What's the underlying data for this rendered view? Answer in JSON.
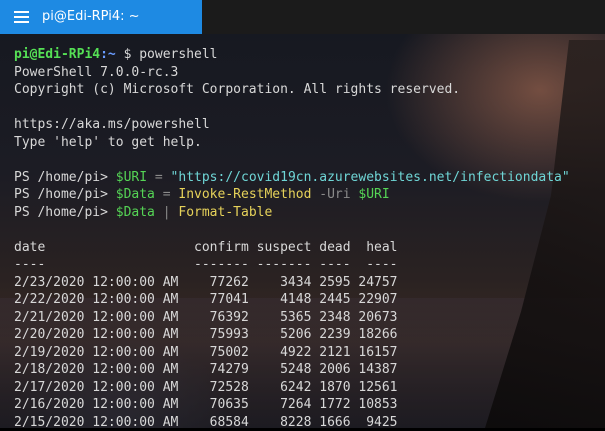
{
  "tab": {
    "title": "pi@Edi-RPi4: ~"
  },
  "terminal": {
    "prompt_user": "pi@Edi-RPi4",
    "prompt_path": ":~",
    "prompt_symbol": " $ ",
    "first_command": "powershell",
    "banner": [
      "PowerShell 7.0.0-rc.3",
      "Copyright (c) Microsoft Corporation. All rights reserved.",
      "",
      "https://aka.ms/powershell",
      "Type 'help' to get help.",
      ""
    ],
    "ps_prompt": "PS /home/pi> ",
    "commands": [
      {
        "var": "$URI",
        "op": " = ",
        "rest": "\"https://covid19cn.azurewebsites.net/infectiondata\""
      },
      {
        "var": "$Data",
        "op": " = ",
        "cmd": "Invoke-RestMethod",
        "param": " -Uri ",
        "var2": "$URI"
      },
      {
        "var": "$Data",
        "op": " | ",
        "cmd": "Format-Table"
      }
    ],
    "table_header": "date                   confirm suspect dead  heal",
    "table_rule": "----                   ------- ------- ----  ----",
    "rows": [
      {
        "date": "2/23/2020 12:00:00 AM",
        "confirm": "77262",
        "suspect": "3434",
        "dead": "2595",
        "heal": "24757"
      },
      {
        "date": "2/22/2020 12:00:00 AM",
        "confirm": "77041",
        "suspect": "4148",
        "dead": "2445",
        "heal": "22907"
      },
      {
        "date": "2/21/2020 12:00:00 AM",
        "confirm": "76392",
        "suspect": "5365",
        "dead": "2348",
        "heal": "20673"
      },
      {
        "date": "2/20/2020 12:00:00 AM",
        "confirm": "75993",
        "suspect": "5206",
        "dead": "2239",
        "heal": "18266"
      },
      {
        "date": "2/19/2020 12:00:00 AM",
        "confirm": "75002",
        "suspect": "4922",
        "dead": "2121",
        "heal": "16157"
      },
      {
        "date": "2/18/2020 12:00:00 AM",
        "confirm": "74279",
        "suspect": "5248",
        "dead": "2006",
        "heal": "14387"
      },
      {
        "date": "2/17/2020 12:00:00 AM",
        "confirm": "72528",
        "suspect": "6242",
        "dead": "1870",
        "heal": "12561"
      },
      {
        "date": "2/16/2020 12:00:00 AM",
        "confirm": "70635",
        "suspect": "7264",
        "dead": "1772",
        "heal": "10853"
      },
      {
        "date": "2/15/2020 12:00:00 AM",
        "confirm": "68584",
        "suspect": "8228",
        "dead": "1666",
        "heal": "9425"
      }
    ]
  },
  "colors": {
    "tab_active": "#1e8ae3",
    "prompt_user": "#55e055",
    "prompt_path": "#6a9cff",
    "variable": "#55d455",
    "string": "#6fd6d6",
    "cmdlet": "#e6d25a"
  }
}
